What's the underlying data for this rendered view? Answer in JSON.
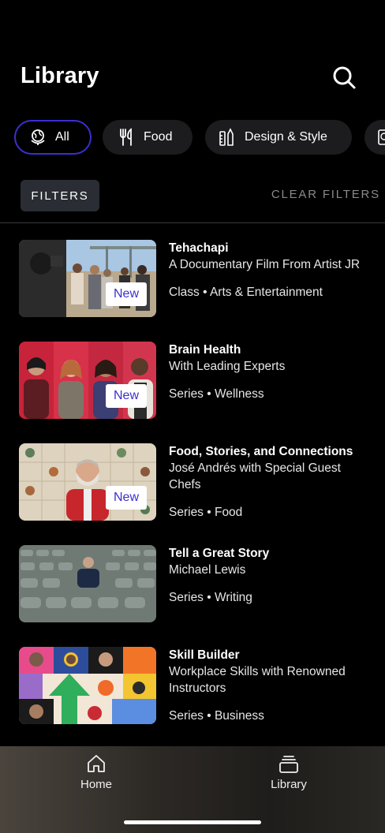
{
  "header": {
    "title": "Library"
  },
  "chips": [
    {
      "label": "All",
      "icon": "globe-icon"
    },
    {
      "label": "Food",
      "icon": "utensils-icon"
    },
    {
      "label": "Design & Style",
      "icon": "design-tools-icon"
    }
  ],
  "filters": {
    "filters_label": "FILTERS",
    "clear_label": "CLEAR FILTERS"
  },
  "items": [
    {
      "title": "Tehachapi",
      "subtitle": "A Documentary Film From Artist JR",
      "meta": "Class • Arts & Entertainment",
      "badge": "New"
    },
    {
      "title": "Brain Health",
      "subtitle": "With Leading Experts",
      "meta": "Series • Wellness",
      "badge": "New"
    },
    {
      "title": "Food, Stories, and Connections",
      "subtitle": "José Andrés with Special Guest Chefs",
      "meta": "Series • Food",
      "badge": "New"
    },
    {
      "title": "Tell a Great Story",
      "subtitle": "Michael Lewis",
      "meta": "Series • Writing",
      "badge": ""
    },
    {
      "title": "Skill Builder",
      "subtitle": "Workplace Skills with Renowned Instructors",
      "meta": "Series • Business",
      "badge": ""
    }
  ],
  "tabbar": {
    "home_label": "Home",
    "library_label": "Library"
  },
  "colors": {
    "accent": "#3b2fd0",
    "background": "#000000",
    "chip_bg": "#1c1c1e"
  }
}
